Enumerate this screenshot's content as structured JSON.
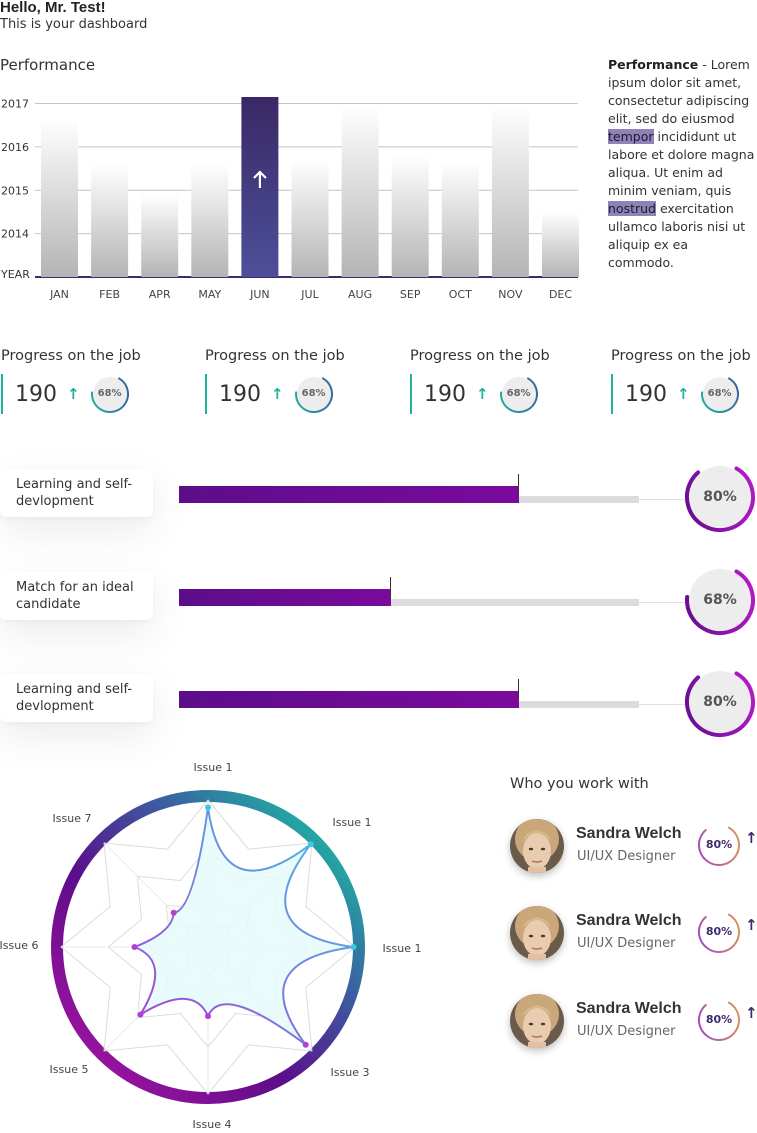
{
  "header": {
    "greeting": "Hello, Mr. Test!",
    "subtitle": "This is your dashboard"
  },
  "performance": {
    "title": "Performance",
    "description": {
      "bold": "Performance",
      "part1": " - Lorem ipsum dolor sit amet, consectetur adipiscing elit, sed do eiusmod ",
      "highlight1": "tempor",
      "part2": " incididunt ut labore et dolore magna aliqua. Ut enim ad minim veniam, quis ",
      "highlight2": "nostrud",
      "part3": " exercitation ullamco laboris nisi ut aliquip ex ea commodo."
    },
    "selected_month": "JUN",
    "selected_icon": "arrow-up-icon"
  },
  "chart_data": [
    {
      "type": "bar",
      "categories": [
        "JAN",
        "FEB",
        "APR",
        "MAY",
        "JUN",
        "JUL",
        "AUG",
        "SEP",
        "OCT",
        "NOV",
        "DEC"
      ],
      "values": [
        2016.65,
        2015.6,
        2014.9,
        2015.6,
        2017.15,
        2015.7,
        2016.95,
        2015.8,
        2015.65,
        2016.95,
        2014.5
      ],
      "ylabel": "YEAR",
      "y_ticks": [
        "2014",
        "2015",
        "2016",
        "2017"
      ],
      "ylim": [
        2013,
        2017.15
      ],
      "grid": true,
      "highlight_category": "JUN",
      "colors": {
        "bar": "#b8b8b8",
        "highlight": "#4a4a96",
        "highlight_top": "#3c2c6a",
        "baseline": "#3c2c6a"
      }
    },
    {
      "type": "radar",
      "categories": [
        "Issue 1",
        "Issue 1",
        "Issue 1",
        "Issue 3",
        "Issue 4",
        "Issue 5",
        "Issue 6",
        "Issue 7"
      ],
      "values": [
        0.95,
        0.99,
        0.99,
        0.94,
        0.47,
        0.65,
        0.5,
        0.33
      ],
      "ylim": [
        0,
        1
      ],
      "grid": true,
      "colors": {
        "line_start": "#3ec8e8",
        "line_end": "#9c3ed0",
        "fill": "#e6fafc"
      }
    }
  ],
  "kpis": [
    {
      "title": "Progress on the job",
      "value": "190",
      "percent_label": "68%",
      "percent": 68,
      "icon": "arrow-up-icon"
    },
    {
      "title": "Progress on the job",
      "value": "190",
      "percent_label": "68%",
      "percent": 68,
      "icon": "arrow-up-icon"
    },
    {
      "title": "Progress on the job",
      "value": "190",
      "percent_label": "68%",
      "percent": 68,
      "icon": "arrow-up-icon"
    },
    {
      "title": "Progress on the job",
      "value": "190",
      "percent_label": "68%",
      "percent": 68,
      "icon": "arrow-up-icon"
    }
  ],
  "progress": [
    {
      "label": "Learning and self-devlopment",
      "value": 74,
      "gauge_label": "80%",
      "gauge": 80
    },
    {
      "label": "Match for an ideal candidate",
      "value": 46,
      "gauge_label": "68%",
      "gauge": 68
    },
    {
      "label": "Learning and self-devlopment",
      "value": 74,
      "gauge_label": "80%",
      "gauge": 80
    }
  ],
  "coworkers": {
    "title": "Who you work with",
    "people": [
      {
        "name": "Sandra Welch",
        "role": "UI/UX Designer",
        "percent_label": "80%",
        "percent": 80,
        "icon": "arrow-up-icon"
      },
      {
        "name": "Sandra Welch",
        "role": "UI/UX Designer",
        "percent_label": "80%",
        "percent": 80,
        "icon": "arrow-up-icon"
      },
      {
        "name": "Sandra Welch",
        "role": "UI/UX Designer",
        "percent_label": "80%",
        "percent": 80,
        "icon": "arrow-up-icon"
      }
    ]
  },
  "colors": {
    "teal": "#20b39a",
    "purple": "#5c0d8a",
    "magenta": "#b316a8",
    "navy": "#3c2c6a"
  }
}
